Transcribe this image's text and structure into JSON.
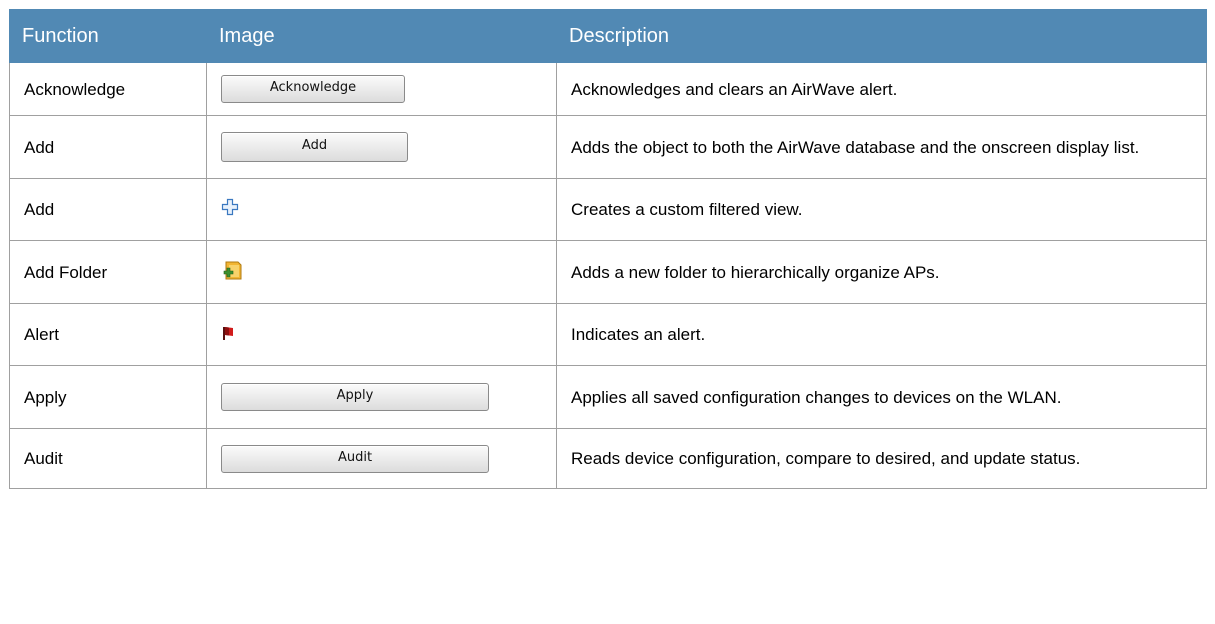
{
  "headers": {
    "function": "Function",
    "image": "Image",
    "description": "Description"
  },
  "rows": [
    {
      "function": "Acknowledge",
      "image_label": "Acknowledge",
      "description": "Acknowledges and clears an AirWave alert."
    },
    {
      "function": "Add",
      "image_label": "Add",
      "description": "Adds the object to both the AirWave database and the onscreen display list."
    },
    {
      "function": "Add",
      "image_icon": "plus-icon",
      "description": "Creates a custom filtered view."
    },
    {
      "function": "Add Folder",
      "image_icon": "add-folder-icon",
      "description": "Adds a new folder to hierarchically organize APs."
    },
    {
      "function": "Alert",
      "image_icon": "red-flag-icon",
      "description": "Indicates an alert."
    },
    {
      "function": "Apply",
      "image_label": "Apply",
      "description": "Applies all saved configuration changes to devices on the WLAN."
    },
    {
      "function": "Audit",
      "image_label": "Audit",
      "description": "Reads device configuration, compare to desired, and update status."
    }
  ],
  "colors": {
    "header_bg": "#5189b4",
    "header_text": "#ffffff",
    "border": "#a0a0a0"
  }
}
